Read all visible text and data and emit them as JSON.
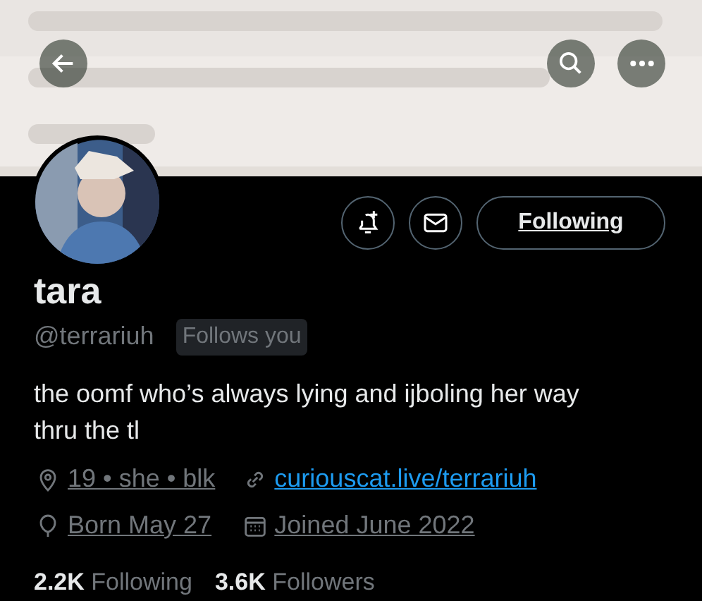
{
  "actions": {
    "follow_button": {
      "label": "Following"
    }
  },
  "profile": {
    "name": "tara",
    "handle": "@terrariuh",
    "follows_you_badge": "Follows you",
    "bio": "the oomf who’s always lying and ijboling her way thru the tl"
  },
  "meta": [
    {
      "kind": "location",
      "text": "19 • she • blk"
    },
    {
      "kind": "link",
      "text": "curiouscat.live/terrariuh"
    },
    {
      "kind": "birthday",
      "text": "Born May 27"
    },
    {
      "kind": "joined",
      "text": "Joined June 2022"
    }
  ],
  "stats": [
    {
      "count": "2.2K",
      "label": "Following"
    },
    {
      "count": "3.6K",
      "label": "Followers"
    }
  ]
}
